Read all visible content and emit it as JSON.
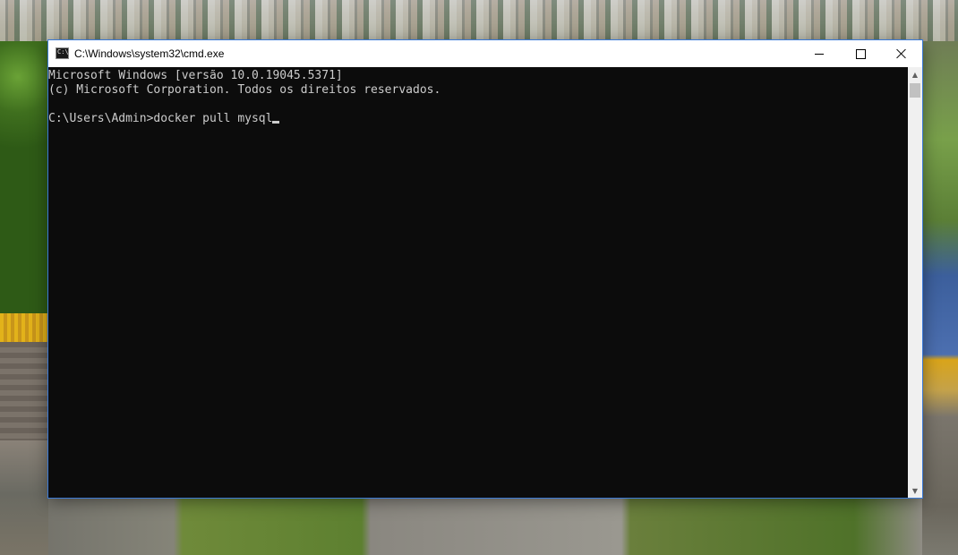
{
  "window": {
    "title": "C:\\Windows\\system32\\cmd.exe",
    "icon": "cmd-icon",
    "icon_text": "C:\\"
  },
  "console": {
    "lines": [
      "Microsoft Windows [versão 10.0.19045.5371]",
      "(c) Microsoft Corporation. Todos os direitos reservados.",
      "",
      "C:\\Users\\Admin>docker pull mysql"
    ],
    "background": "#0c0c0c",
    "foreground": "#cccccc"
  },
  "scrollbar": {
    "up_arrow": "▲",
    "down_arrow": "▼"
  },
  "caption_buttons": {
    "minimize": "minimize-icon",
    "maximize": "maximize-icon",
    "close": "close-icon"
  }
}
